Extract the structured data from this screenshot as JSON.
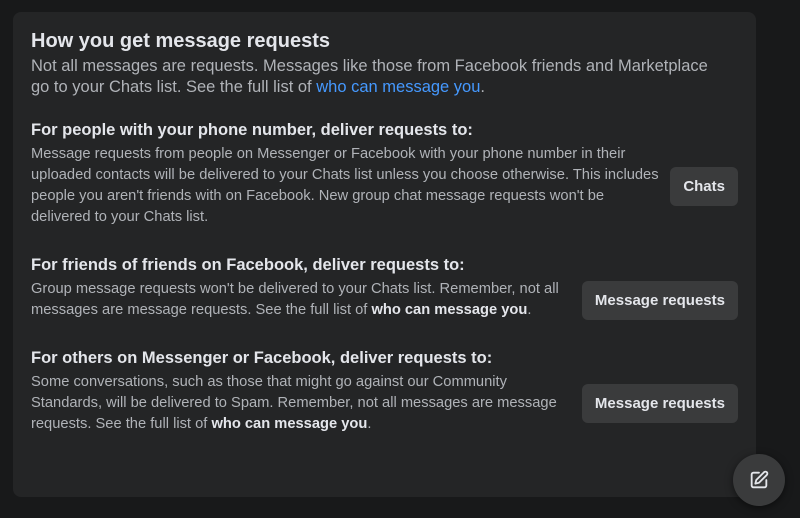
{
  "header": {
    "title": "How you get message requests",
    "intro_text": "Not all messages are requests. Messages like those from Facebook friends and Marketplace go to your Chats list. See the full list of ",
    "intro_link": "who can message you",
    "intro_end": "."
  },
  "sections": [
    {
      "heading": "For people with your phone number, deliver requests to:",
      "description": "Message requests from people on Messenger or Facebook with your phone number in their uploaded contacts will be delivered to your Chats list unless you choose otherwise. This includes people you aren't friends with on Facebook. New group chat message requests won't be delivered to your Chats list.",
      "button_label": "Chats"
    },
    {
      "heading": "For friends of friends on Facebook, deliver requests to:",
      "description": "Group message requests won't be delivered to your Chats list. Remember, not all messages are message requests. See the full list of ",
      "link": "who can message you",
      "link_end": ".",
      "button_label": "Message requests"
    },
    {
      "heading": "For others on Messenger or Facebook, deliver requests to:",
      "description": "Some conversations, such as those that might go against our Community Standards, will be delivered to Spam. Remember, not all messages are message requests. See the full list of ",
      "link": "who can message you",
      "link_end": ".",
      "button_label": "Message requests"
    }
  ],
  "fab": {
    "icon": "compose-icon"
  },
  "colors": {
    "background": "#18191a",
    "card": "#242526",
    "button": "#3a3b3c",
    "link": "#4599ff",
    "primary_text": "#e4e6eb",
    "secondary_text": "#b0b3b8"
  }
}
